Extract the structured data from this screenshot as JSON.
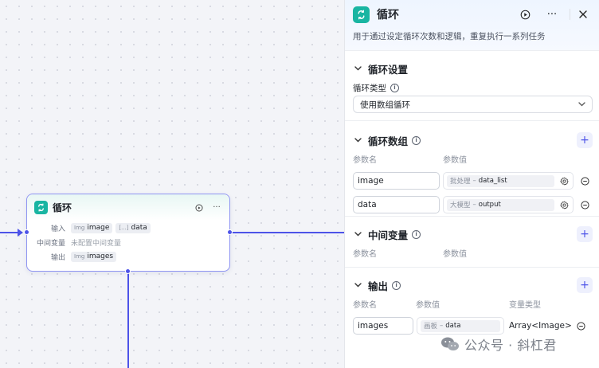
{
  "node": {
    "title": "循环",
    "input_label": "输入",
    "input_chips": [
      {
        "type": "Img",
        "name": "image"
      },
      {
        "type": "[...]",
        "name": "data"
      }
    ],
    "mid_label": "中间变量",
    "mid_value": "未配置中间变量",
    "output_label": "输出",
    "output_chips": [
      {
        "type": "Img",
        "name": "images"
      }
    ]
  },
  "panel": {
    "title": "循环",
    "description": "用于通过设定循环次数和逻辑，重复执行一系列任务",
    "settings": {
      "title": "循环设置",
      "loop_type_label": "循环类型",
      "loop_type_value": "使用数组循环"
    },
    "array": {
      "title": "循环数组",
      "col_name": "参数名",
      "col_value": "参数值",
      "rows": [
        {
          "name": "image",
          "source": "批处理",
          "var": "data_list"
        },
        {
          "name": "data",
          "source": "大模型",
          "var": "output"
        }
      ]
    },
    "mid_vars": {
      "title": "中间变量",
      "col_name": "参数名",
      "col_value": "参数值"
    },
    "output": {
      "title": "输出",
      "col_name": "参数名",
      "col_value": "参数值",
      "col_type": "变量类型",
      "rows": [
        {
          "name": "images",
          "source": "画板",
          "var": "data",
          "type": "Array<Image>"
        }
      ]
    }
  },
  "watermark": "公众号 · 斜杠君",
  "colors": {
    "accent": "#4d53e8",
    "node_icon": "#19b5a2"
  }
}
